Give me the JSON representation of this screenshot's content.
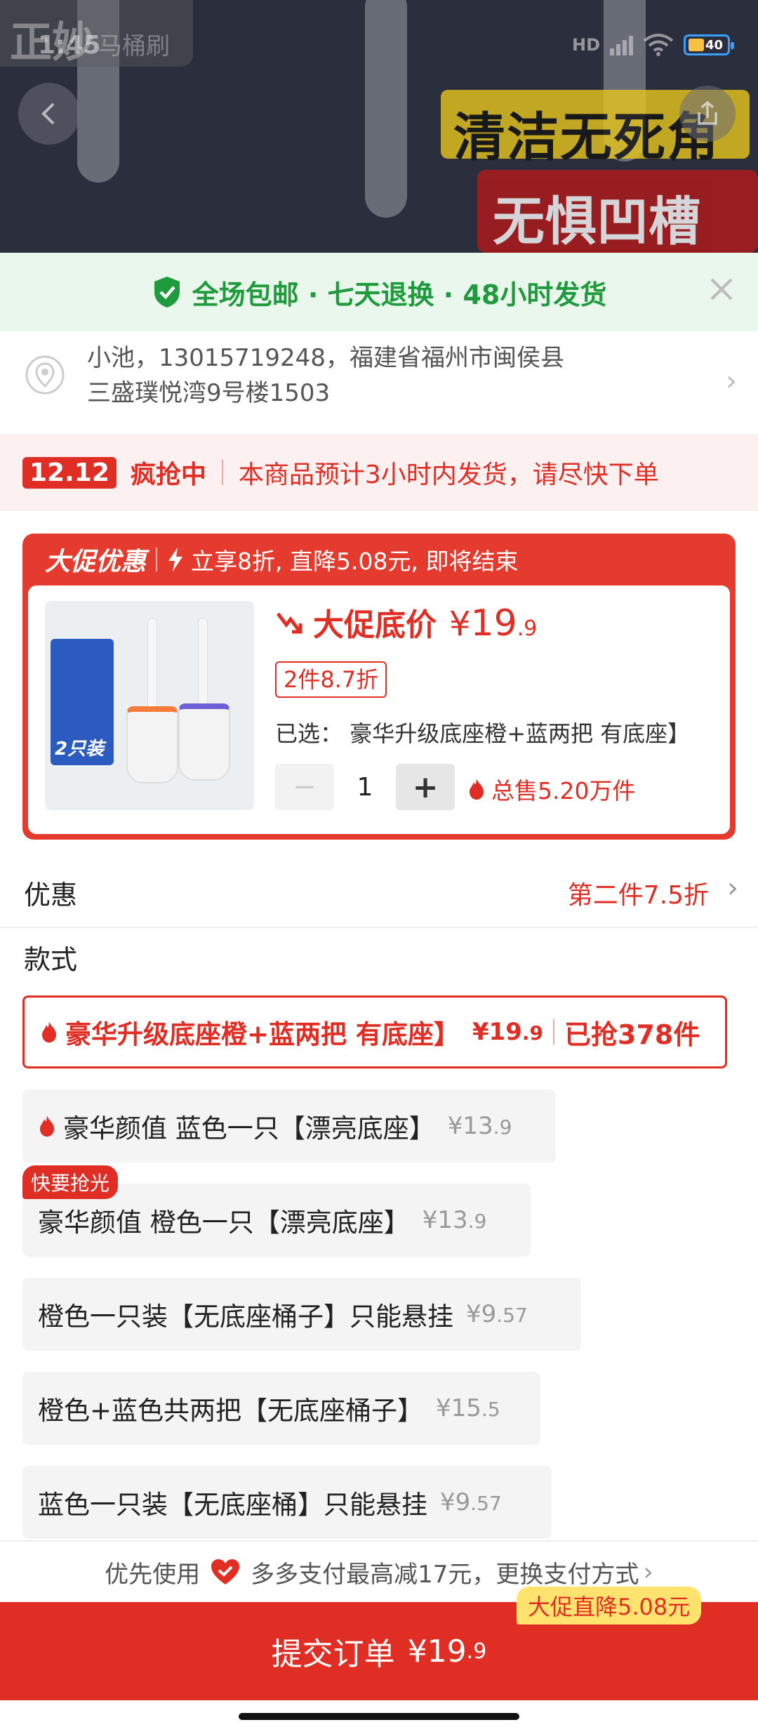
{
  "watermark": {
    "logo": "正妙",
    "text": "马桶刷"
  },
  "status_bar": {
    "time": "1:45",
    "signal": "HD",
    "battery": "40"
  },
  "banner": {
    "line1": "清洁无死角",
    "line2": "无惧凹槽"
  },
  "guarantee": {
    "text": "全场包邮 · 七天退换 · 48小时发货"
  },
  "address": {
    "line1": "小池，13015719248，福建省福州市闽侯县",
    "line2": "三盛璞悦湾9号楼1503"
  },
  "promo": {
    "tag": "12.12",
    "label": "疯抢中",
    "message": "本商品预计3小时内发货，请尽快下单"
  },
  "deal": {
    "title": "大促优惠",
    "message": "立享8折, 直降5.08元, 即将结束",
    "price_label": "大促底价",
    "price_yen": "¥",
    "price_int": "19",
    "price_dec": ".9",
    "discount_chip": "2件8.7折",
    "selected_label": "已选：",
    "selected_value": "豪华升级底座橙+蓝两把 有底座】",
    "quantity": "1",
    "minus": "−",
    "plus": "+",
    "total_sold": "总售5.20万件",
    "image_label": "2只装"
  },
  "coupon": {
    "label": "优惠",
    "value": "第二件7.5折",
    "chevron": "›"
  },
  "style_title": "款式",
  "options": [
    {
      "name": "豪华升级底座橙+蓝两把 有底座】",
      "price_int": "¥19",
      "price_dec": ".9",
      "sold": "已抢378件"
    },
    {
      "name": "豪华颜值 蓝色一只【漂亮底座】",
      "price_int": "¥13",
      "price_dec": ".9"
    },
    {
      "name": "豪华颜值 橙色一只【漂亮底座】",
      "price_int": "¥13",
      "price_dec": ".9"
    },
    {
      "name": "橙色一只装【无底座桶子】只能悬挂",
      "price_int": "¥9",
      "price_dec": ".57"
    },
    {
      "name": "橙色+蓝色共两把【无底座桶子】",
      "price_int": "¥15",
      "price_dec": ".5"
    },
    {
      "name": "蓝色一只装【无底座桶】只能悬挂",
      "price_int": "¥9",
      "price_dec": ".57"
    }
  ],
  "soon_badge": "快要抢光",
  "pay": {
    "prefix": "优先使用",
    "text": "多多支付最高减17元，更换支付方式",
    "chevron": "›"
  },
  "submit": {
    "label": "提交订单",
    "yen": "¥19",
    "dec": ".9",
    "save_tag": "大促直降5.08元"
  },
  "colors": {
    "accent": "#e02e24",
    "green": "#1f9a3c",
    "yellow_tag": "#ffe36e"
  }
}
